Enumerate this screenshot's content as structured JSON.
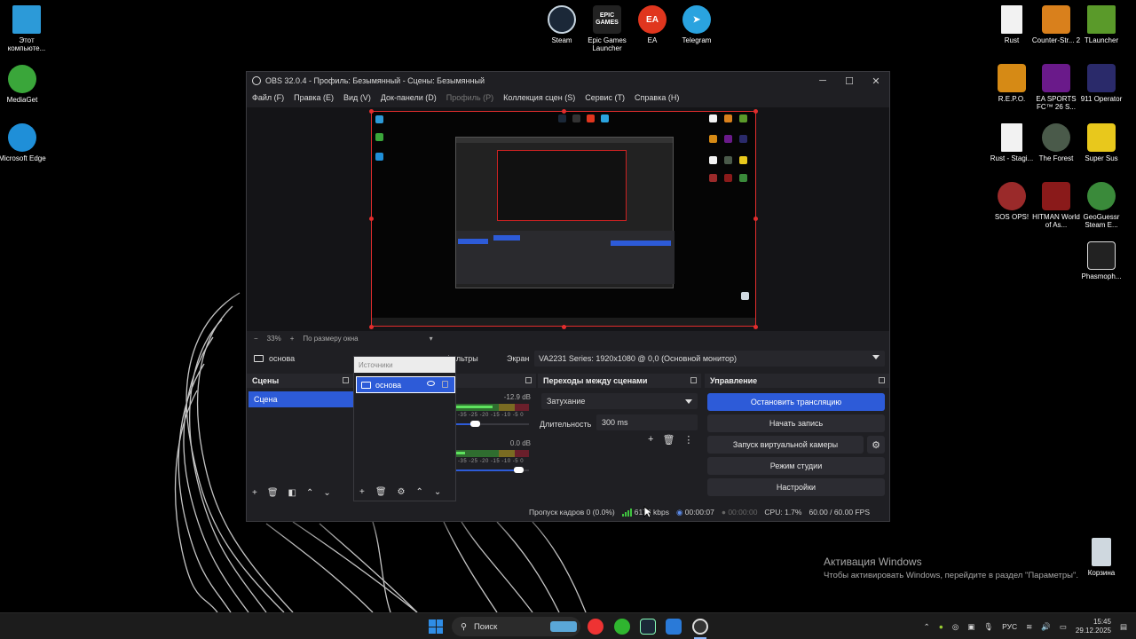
{
  "desktop": {
    "icons_left": [
      {
        "label": "Этот компьюте...",
        "icon": "this-pc-icon",
        "color": "#2c9ad8"
      },
      {
        "label": "MediaGet",
        "icon": "mediaget-icon",
        "color": "#3aa63a"
      },
      {
        "label": "Microsoft Edge",
        "icon": "edge-icon",
        "color": "#1f8fd8"
      }
    ],
    "icons_top": [
      {
        "label": "Steam",
        "icon": "steam-icon",
        "color": "#1b2838"
      },
      {
        "label": "Epic Games Launcher",
        "icon": "epic-games-icon",
        "color": "#222",
        "glyph": "EPIC GAMES"
      },
      {
        "label": "EA",
        "icon": "ea-icon",
        "color": "#e0361e",
        "glyph": "EA"
      },
      {
        "label": "Telegram",
        "icon": "telegram-icon",
        "color": "#2aa3df"
      }
    ],
    "icons_right": [
      {
        "label": "Rust",
        "icon": "file-icon",
        "color": "#f2f2f2"
      },
      {
        "label": "Counter-Str... 2",
        "icon": "cs2-icon",
        "color": "#d9801c"
      },
      {
        "label": "TLauncher",
        "icon": "tlauncher-icon",
        "color": "#5a9a2a"
      },
      {
        "label": "R.E.P.O.",
        "icon": "repo-icon",
        "color": "#d68a15"
      },
      {
        "label": "EA SPORTS FC™ 26 S...",
        "icon": "ea-fc-icon",
        "color": "#6a1a8a"
      },
      {
        "label": "911 Operator",
        "icon": "operator-911-icon",
        "color": "#2a2a6a"
      },
      {
        "label": "Rust - Stagi...",
        "icon": "file-icon",
        "color": "#f2f2f2"
      },
      {
        "label": "The Forest",
        "icon": "the-forest-icon",
        "color": "#4a5a4a"
      },
      {
        "label": "Super Sus",
        "icon": "super-sus-icon",
        "color": "#e8c81c"
      },
      {
        "label": "SOS OPS!",
        "icon": "sos-ops-icon",
        "color": "#9a2a2a"
      },
      {
        "label": "HITMAN World of As...",
        "icon": "hitman-icon",
        "color": "#8a1a1a"
      },
      {
        "label": "GeoGuessr Steam E...",
        "icon": "geoguessr-icon",
        "color": "#3a8a3a"
      },
      {
        "label": "Phasmoph...",
        "icon": "phasmophobia-icon",
        "color": "#222"
      }
    ],
    "recycle_bin": "Корзина"
  },
  "obs": {
    "title": "OBS 32.0.4 - Профиль: Безымянный - Сцены: Безымянный",
    "menu": [
      {
        "label": "Файл (F)",
        "enabled": true
      },
      {
        "label": "Правка (E)",
        "enabled": true
      },
      {
        "label": "Вид (V)",
        "enabled": true
      },
      {
        "label": "Док-панели (D)",
        "enabled": true
      },
      {
        "label": "Профиль (P)",
        "enabled": false
      },
      {
        "label": "Коллекция сцен (S)",
        "enabled": true
      },
      {
        "label": "Сервис (T)",
        "enabled": true
      },
      {
        "label": "Справка (H)",
        "enabled": true
      }
    ],
    "zoom": {
      "minus": "−",
      "value": "33%",
      "plus": "+",
      "mode": "По размеру окна"
    },
    "source_toolbar": {
      "name": "основа",
      "filters": "Фильтры",
      "screen_label": "Экран",
      "screen_value": "VA2231 Series: 1920x1080 @ 0,0 (Основной монитор)"
    },
    "scenes": {
      "header": "Сцены",
      "items": [
        "Сцена"
      ]
    },
    "sources": {
      "header": "Источники",
      "items": [
        {
          "name": "основа"
        }
      ]
    },
    "mixer": {
      "channels": [
        {
          "db": "-12.9 dB",
          "level": 0.5,
          "volume": 0.22
        },
        {
          "db": "0.0 dB",
          "level": 0.12,
          "volume": 0.92
        }
      ],
      "scale": "-35 -25 -20 -15 -10 -5 0"
    },
    "transitions": {
      "header": "Переходы между сценами",
      "selected": "Затухание",
      "duration_label": "Длительность",
      "duration_value": "300 ms"
    },
    "controls": {
      "header": "Управление",
      "stop_stream": "Остановить трансляцию",
      "start_record": "Начать запись",
      "virtual_cam": "Запуск виртуальной камеры",
      "studio_mode": "Режим студии",
      "settings": "Настройки"
    },
    "status": {
      "dropped": "Пропуск кадров 0 (0.0%)",
      "bitrate": "6170 kbps",
      "stream_time": "00:00:07",
      "record_time": "00:00:00",
      "cpu": "CPU: 1.7%",
      "fps": "60.00 / 60.00 FPS"
    }
  },
  "activation": {
    "line1": "Активация Windows",
    "line2": "Чтобы активировать Windows, перейдите в раздел \"Параметры\"."
  },
  "taskbar": {
    "search_placeholder": "Поиск",
    "language": "РУС",
    "time": "15:45",
    "date": "29.12.2025"
  },
  "colors": {
    "accent": "#2d5bd8",
    "selection_border": "#e22d2d",
    "panel": "#1f1f23"
  }
}
